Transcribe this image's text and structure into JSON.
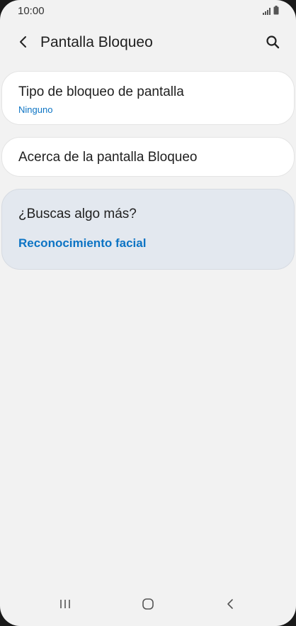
{
  "status_bar": {
    "time": "10:00",
    "icons": [
      "signal-icon",
      "battery-icon"
    ]
  },
  "header": {
    "title": "Pantalla Bloqueo",
    "back_icon": "chevron-left-icon",
    "search_icon": "search-icon"
  },
  "settings": {
    "lock_type": {
      "label": "Tipo de bloqueo de pantalla",
      "value": "Ninguno"
    },
    "about": {
      "label": "Acerca de la pantalla Bloqueo"
    }
  },
  "suggestions": {
    "heading": "¿Buscas algo más?",
    "link": "Reconocimiento facial"
  },
  "nav_bar": {
    "recents_icon": "recents-icon",
    "home_icon": "home-icon",
    "back_icon": "back-icon"
  },
  "colors": {
    "background": "#f2f2f2",
    "card": "#ffffff",
    "accent": "#0d74c4",
    "suggest_card": "#e3e8ef"
  }
}
